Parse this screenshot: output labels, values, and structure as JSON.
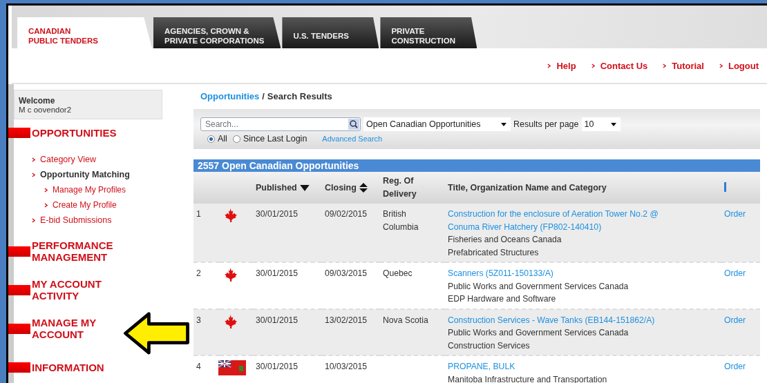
{
  "tabs": [
    {
      "label": "CANADIAN\nPUBLIC TENDERS",
      "selected": true
    },
    {
      "label": "AGENCIES, CROWN &\nPRIVATE CORPORATIONS",
      "selected": false
    },
    {
      "label": "U.S. TENDERS",
      "selected": false
    },
    {
      "label": "PRIVATE\nCONSTRUCTION",
      "selected": false
    }
  ],
  "top_links": [
    "Help",
    "Contact Us",
    "Tutorial",
    "Logout"
  ],
  "welcome": {
    "title": "Welcome",
    "user": "M c oovendor2"
  },
  "sidebar": [
    {
      "label": "OPPORTUNITIES",
      "children": [
        {
          "label": "Category View",
          "selected": false
        },
        {
          "label": "Opportunity Matching",
          "selected": true,
          "children": [
            {
              "label": "Manage My Profiles",
              "selected": false
            },
            {
              "label": "Create My Profile",
              "selected": false
            }
          ]
        },
        {
          "label": "E-bid Submissions",
          "selected": false
        }
      ]
    },
    {
      "label": "PERFORMANCE\nMANAGEMENT"
    },
    {
      "label": "MY ACCOUNT\nACTIVITY"
    },
    {
      "label": "MANAGE MY\nACCOUNT",
      "pointer": true
    },
    {
      "label": "INFORMATION"
    }
  ],
  "breadcrumb": {
    "link": "Opportunities",
    "separator": "/",
    "current": "Search Results"
  },
  "search": {
    "placeholder": "Search...",
    "scope": "Open Canadian Opportunities",
    "per_page_label": "Results per page",
    "per_page": "10",
    "radios": [
      {
        "label": "All",
        "selected": true
      },
      {
        "label": "Since Last Login",
        "selected": false
      }
    ],
    "advanced": "Advanced Search"
  },
  "results": {
    "title": "2557 Open Canadian Opportunities",
    "columns": [
      "Published",
      "Closing",
      "Reg. Of\nDelivery",
      "Title, Organization Name and Category"
    ],
    "rows": [
      {
        "num": "1",
        "kind": "canada",
        "published": "30/01/2015",
        "closing": "09/02/2015",
        "region": "British\nColumbia",
        "title": "Construction for the enclosure of Aeration Tower No.2 @ Conuma River Hatchery (FP802-140410)",
        "organization": "Fisheries and Oceans Canada",
        "category": "Prefabricated Structures",
        "action": "Order"
      },
      {
        "num": "2",
        "kind": "canada",
        "published": "30/01/2015",
        "closing": "09/03/2015",
        "region": "Quebec",
        "title": "Scanners (5Z011-150133/A)",
        "organization": "Public Works and Government Services Canada",
        "category": "EDP Hardware and Software",
        "action": "Order"
      },
      {
        "num": "3",
        "kind": "canada",
        "published": "30/01/2015",
        "closing": "13/02/2015",
        "region": "Nova Scotia",
        "title": "Construction Services - Wave Tanks (EB144-151862/A)",
        "organization": "Public Works and Government Services Canada",
        "category": "Construction Services",
        "action": "Order"
      },
      {
        "num": "4",
        "kind": "manitoba",
        "published": "30/01/2015",
        "closing": "10/03/2015",
        "title": "PROPANE, BULK",
        "organization": "Manitoba Infrastructure and Transportation",
        "action": "Order"
      }
    ]
  }
}
